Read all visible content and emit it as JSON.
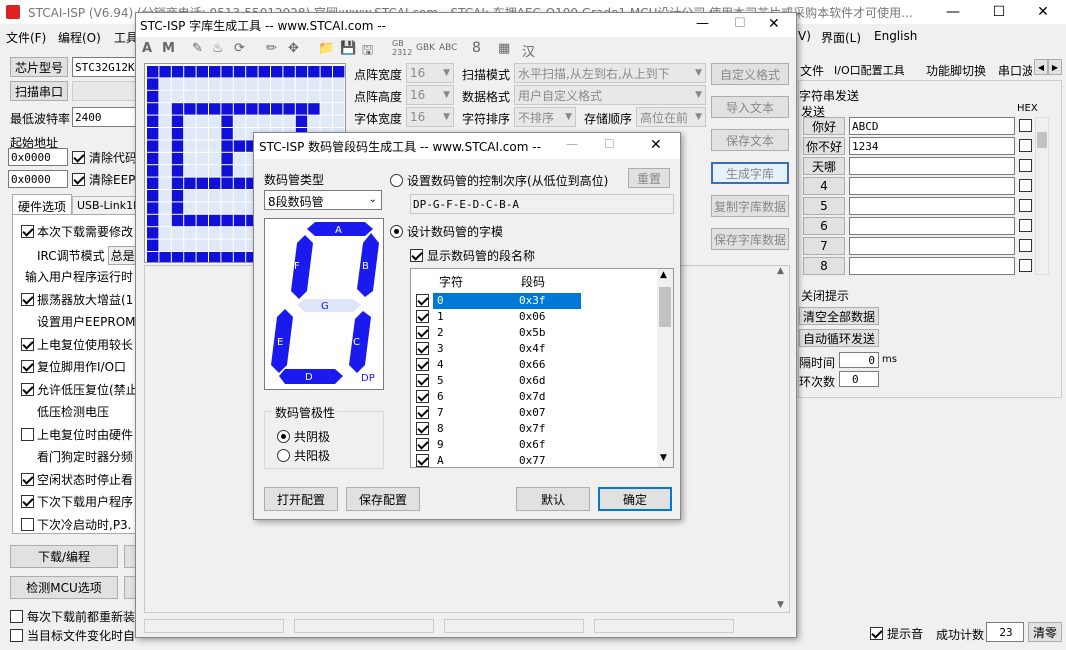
{
  "main_window": {
    "title": "STCAI-ISP (V6.94) (分销商电话: 0513-55012928) 官网:www.STCAI.com  --STCAI: 东拥AEC-Q100 Grade1 MCU设计公司,使用本司芯片或采购本软件才可使用...",
    "menu": [
      "文件(F)",
      "编程(O)",
      "工具"
    ],
    "menu_right": [
      "界面(L)",
      "English"
    ],
    "menu_v": "V)",
    "chip_label": "芯片型号",
    "chip_value": "STC32G12K1",
    "scan_port": "扫描串口",
    "baud_label": "最低波特率",
    "baud_value": "2400",
    "start_addr_label": "起始地址",
    "addr1": "0x0000",
    "clear_code": "清除代码",
    "addr2": "0x0000",
    "clear_eeprom": "清除EEPR",
    "hw_tab": "硬件选项",
    "usb_tab": "USB-Link1D",
    "options": [
      {
        "label": "本次下载需要修改",
        "checked": true,
        "cb": true
      },
      {
        "label": "IRC调节模式",
        "checked": false,
        "cb": false,
        "extra": "总是"
      },
      {
        "label": "输入用户程序运行时",
        "checked": false,
        "cb": false
      },
      {
        "label": "振荡器放大增益(1",
        "checked": true,
        "cb": true
      },
      {
        "label": "设置用户EEPROM大",
        "checked": false,
        "cb": false
      },
      {
        "label": "上电复位使用较长",
        "checked": true,
        "cb": true
      },
      {
        "label": "复位脚用作I/O口",
        "checked": true,
        "cb": true
      },
      {
        "label": "允许低压复位(禁止",
        "checked": true,
        "cb": true
      },
      {
        "label": "低压检测电压",
        "checked": false,
        "cb": false
      },
      {
        "label": "上电复位时由硬件",
        "checked": false,
        "cb": true
      },
      {
        "label": "看门狗定时器分频",
        "checked": false,
        "cb": false
      },
      {
        "label": "空闲状态时停止看",
        "checked": true,
        "cb": true
      },
      {
        "label": "下次下载用户程序",
        "checked": true,
        "cb": true
      },
      {
        "label": "下次冷启动时,P3.",
        "checked": false,
        "cb": true
      }
    ],
    "download_btn": "下载/编程",
    "detect_btn": "检测MCU选项",
    "bottom_cb1": "每次下载前都重新装",
    "bottom_cb2": "当目标文件变化时自",
    "right_tabs": [
      "文件",
      "I/O口配置工具",
      "功能脚切换",
      "串口波"
    ],
    "serial_title": "字符串发送",
    "send_label": "发送",
    "hex_label": "HEX",
    "send_rows": [
      {
        "btn": "你好",
        "value": "ABCD"
      },
      {
        "btn": "你不好",
        "value": "1234"
      },
      {
        "btn": "天哪",
        "value": ""
      },
      {
        "btn": "4",
        "value": ""
      },
      {
        "btn": "5",
        "value": ""
      },
      {
        "btn": "6",
        "value": ""
      },
      {
        "btn": "7",
        "value": ""
      },
      {
        "btn": "8",
        "value": ""
      }
    ],
    "close_tip": "关闭提示",
    "clear_all": "清空全部数据",
    "auto_loop": "自动循环发送",
    "interval_label": "隔时间",
    "interval_value": "0",
    "interval_unit": "ms",
    "loop_label": "环次数",
    "loop_value": "0",
    "beep_label": "提示音",
    "success_label": "成功计数",
    "success_value": "23",
    "clear_btn": "清零"
  },
  "font_window": {
    "title": "STC-ISP 字库生成工具 -- www.STCAI.com --",
    "toolbar_text": [
      "GB 2312",
      "GBK",
      "ABC",
      "8",
      "汉"
    ],
    "fields": [
      {
        "label": "点阵宽度",
        "value": "16"
      },
      {
        "label": "点阵高度",
        "value": "16"
      },
      {
        "label": "字体宽度",
        "value": "16"
      }
    ],
    "scan_mode_label": "扫描模式",
    "scan_mode_value": "水平扫描,从左到右,从上到下",
    "data_format_label": "数据格式",
    "data_format_value": "用户自定义格式",
    "char_order_label": "字符排序",
    "char_order_value": "不排序",
    "store_order_label": "存储顺序",
    "store_order_value": "高位在前",
    "buttons": [
      "自定义格式",
      "导入文本",
      "保存文本",
      "生成字库",
      "复制字库数据",
      "保存字库数据"
    ]
  },
  "seg_dialog": {
    "title": "STC-ISP 数码管段码生成工具 -- www.STCAI.com --",
    "type_label": "数码管类型",
    "type_value": "8段数码管",
    "set_order_label": "设置数码管的控制次序(从低位到高位)",
    "reset_btn": "重置",
    "order_value": "DP-G-F-E-D-C-B-A",
    "design_label": "设计数码管的字模",
    "show_names_label": "显示数码管的段名称",
    "col_char": "字符",
    "col_code": "段码",
    "rows": [
      {
        "char": "0",
        "code": "0x3f"
      },
      {
        "char": "1",
        "code": "0x06"
      },
      {
        "char": "2",
        "code": "0x5b"
      },
      {
        "char": "3",
        "code": "0x4f"
      },
      {
        "char": "4",
        "code": "0x66"
      },
      {
        "char": "5",
        "code": "0x6d"
      },
      {
        "char": "6",
        "code": "0x7d"
      },
      {
        "char": "7",
        "code": "0x07"
      },
      {
        "char": "8",
        "code": "0x7f"
      },
      {
        "char": "9",
        "code": "0x6f"
      },
      {
        "char": "A",
        "code": "0x77"
      }
    ],
    "segments": {
      "a": "A",
      "b": "B",
      "c": "C",
      "d": "D",
      "e": "E",
      "f": "F",
      "g": "G",
      "dp": "DP"
    },
    "polarity_label": "数码管极性",
    "polarity_cathode": "共阴极",
    "polarity_anode": "共阳极",
    "open_cfg": "打开配置",
    "save_cfg": "保存配置",
    "default_btn": "默认",
    "ok_btn": "确定",
    "active_color": "#1a1aee",
    "selected_row_color": "#0078d7"
  }
}
